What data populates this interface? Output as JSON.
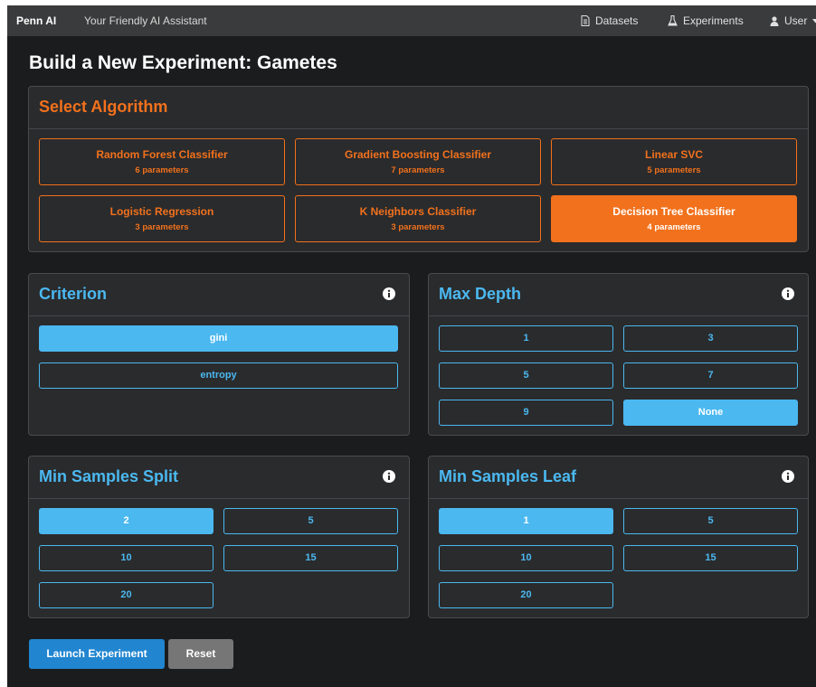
{
  "navbar": {
    "brand": "Penn AI",
    "tagline": "Your Friendly AI Assistant",
    "datasets": "Datasets",
    "experiments": "Experiments",
    "user": "User"
  },
  "page": {
    "title": "Build a New Experiment: Gametes"
  },
  "algorithm": {
    "title": "Select Algorithm",
    "items": [
      {
        "name": "Random Forest Classifier",
        "params": "6 parameters"
      },
      {
        "name": "Gradient Boosting Classifier",
        "params": "7 parameters"
      },
      {
        "name": "Linear SVC",
        "params": "5 parameters"
      },
      {
        "name": "Logistic Regression",
        "params": "3 parameters"
      },
      {
        "name": "K Neighbors Classifier",
        "params": "3 parameters"
      },
      {
        "name": "Decision Tree Classifier",
        "params": "4 parameters"
      }
    ],
    "selected": "Decision Tree Classifier"
  },
  "criterion": {
    "title": "Criterion",
    "options": [
      "gini",
      "entropy"
    ],
    "selected": "gini"
  },
  "max_depth": {
    "title": "Max Depth",
    "options": [
      "1",
      "3",
      "5",
      "7",
      "9",
      "None"
    ],
    "selected": "None"
  },
  "min_samples_split": {
    "title": "Min Samples Split",
    "options": [
      "2",
      "5",
      "10",
      "15",
      "20"
    ],
    "selected": "2"
  },
  "min_samples_leaf": {
    "title": "Min Samples Leaf",
    "options": [
      "1",
      "5",
      "10",
      "15",
      "20"
    ],
    "selected": "1"
  },
  "actions": {
    "launch": "Launch Experiment",
    "reset": "Reset"
  },
  "colors": {
    "orange": "#f2711c",
    "blue": "#4bb8f0",
    "primary": "#2185d0",
    "grey": "#767676"
  },
  "icons": [
    "file-icon",
    "flask-icon",
    "user-icon",
    "caret-down-icon",
    "info-circle-icon"
  ]
}
